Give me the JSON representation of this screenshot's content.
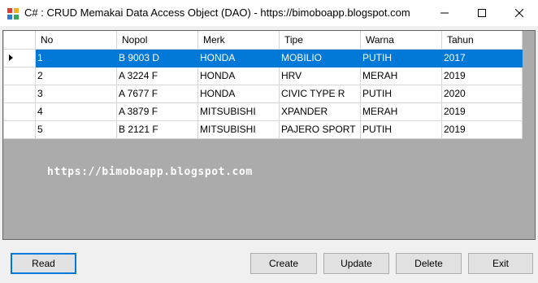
{
  "window": {
    "title": "C# : CRUD Memakai Data Access Object (DAO) - https://bimoboapp.blogspot.com",
    "icon": "app-window-icon",
    "controls": [
      "minimize-icon",
      "maximize-icon",
      "close-icon"
    ]
  },
  "grid": {
    "columns": [
      "No",
      "Nopol",
      "Merk",
      "Tipe",
      "Warna",
      "Tahun"
    ],
    "rows": [
      [
        "1",
        "B 9003 D",
        "HONDA",
        "MOBILIO",
        "PUTIH",
        "2017"
      ],
      [
        "2",
        "A 3224 F",
        "HONDA",
        "HRV",
        "MERAH",
        "2019"
      ],
      [
        "3",
        "A 7677 F",
        "HONDA",
        "CIVIC TYPE R",
        "PUTIH",
        "2020"
      ],
      [
        "4",
        "A 3879 F",
        "MITSUBISHI",
        "XPANDER",
        "MERAH",
        "2019"
      ],
      [
        "5",
        "B 2121 F",
        "MITSUBISHI",
        "PAJERO SPORT",
        "PUTIH",
        "2019"
      ]
    ],
    "selected_row": 0,
    "selection_color": "#0078d7",
    "background_color": "#ababab"
  },
  "watermark": "https://bimoboapp.blogspot.com",
  "buttons": {
    "read": "Read",
    "create": "Create",
    "update": "Update",
    "delete": "Delete",
    "exit": "Exit"
  }
}
